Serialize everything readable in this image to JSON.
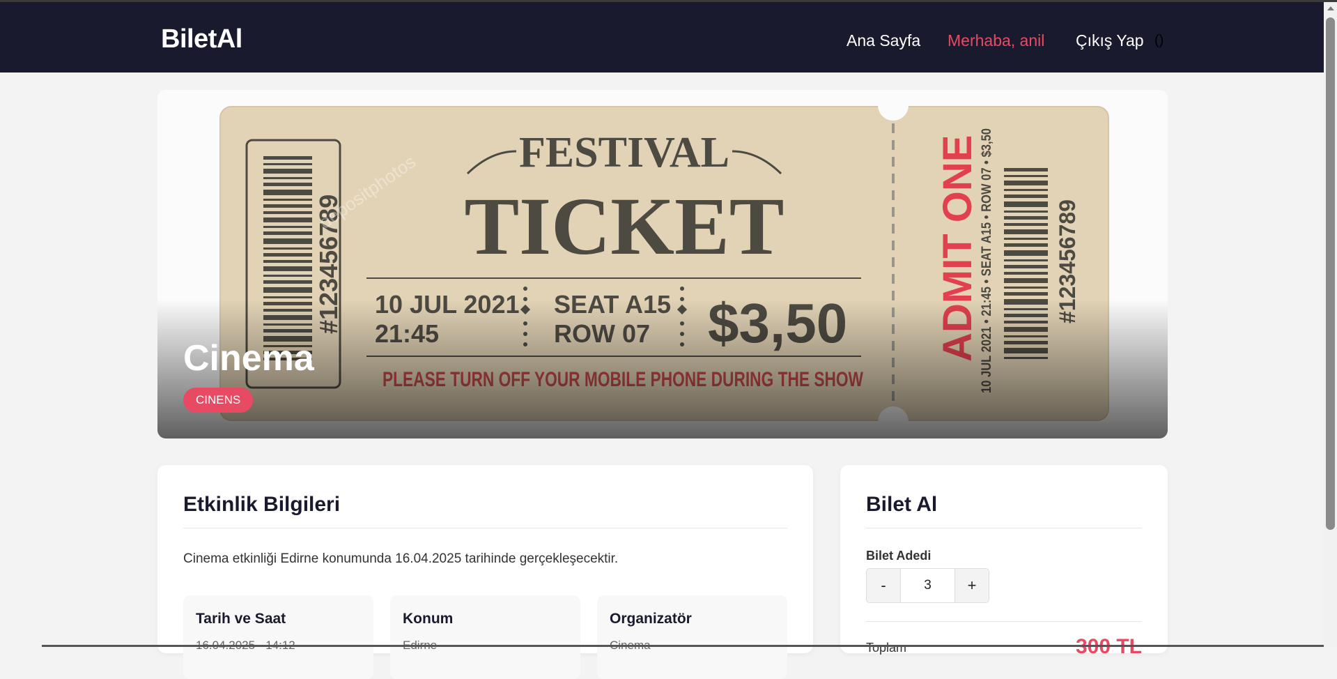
{
  "navbar": {
    "brand": "BiletAl",
    "links": {
      "home": "Ana Sayfa",
      "greeting": "Merhaba, anil",
      "logout": "Çıkış Yap",
      "extra": "()"
    }
  },
  "hero": {
    "title": "Cinema",
    "badge": "CINENS",
    "ticket": {
      "header": "FESTIVAL",
      "main": "TICKET",
      "date": "10 JUL 2021",
      "time": "21:45",
      "seat": "SEAT A15",
      "row": "ROW 07",
      "price": "$3,50",
      "notice": "PLEASE TURN OFF YOUR MOBILE PHONE DURING THE SHOW",
      "number": "#123456789",
      "admit": "ADMIT ONE",
      "stub_line": "10 JUL 2021 • 21:45 • SEAT A15 • ROW 07 • $3,50",
      "stub_number": "#123456789",
      "watermark": "depositphotos"
    }
  },
  "info": {
    "title": "Etkinlik Bilgileri",
    "description": "Cinema etkinliği Edirne konumunda 16.04.2025 tarihinde gerçekleşecektir.",
    "boxes": [
      {
        "title": "Tarih ve Saat",
        "value": "16.04.2025 - 14:12"
      },
      {
        "title": "Konum",
        "value": "Edirne"
      },
      {
        "title": "Organizatör",
        "value": "Cinema"
      }
    ]
  },
  "buy": {
    "title": "Bilet Al",
    "quantity_label": "Bilet Adedi",
    "minus": "-",
    "plus": "+",
    "quantity": "3",
    "total_label": "Toplam",
    "total_value": "300 TL"
  },
  "colors": {
    "navbar": "#1a1a2e",
    "accent": "#e84a64",
    "ticket_paper": "#e2d3b6",
    "ticket_ink": "#4d4a42"
  }
}
